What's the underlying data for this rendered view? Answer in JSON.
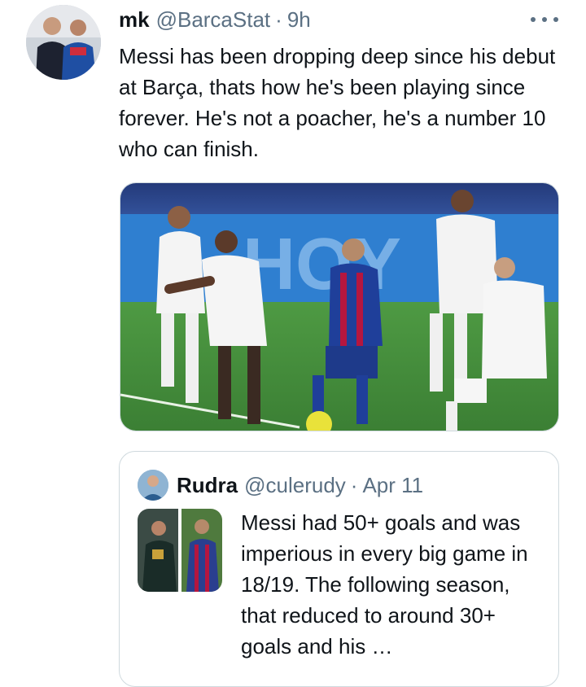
{
  "tweet": {
    "author_name": "mk",
    "author_handle": "@BarcaStat",
    "separator": "·",
    "time": "9h",
    "text": "Messi has been dropping deep since his debut at Barça, thats how he's been playing since forever. He's not a poacher, he's a number 10 who can finish.",
    "media_banner_text": "HOY",
    "more_icon": "more-horizontal-icon"
  },
  "quote": {
    "author_name": "Rudra",
    "author_handle": "@culerudy",
    "separator": "·",
    "date": "Apr 11",
    "text": "Messi had 50+ goals and was imperious in every big game in 18/19. The following season, that reduced to around 30+ goals and his …"
  },
  "colors": {
    "secondary_text": "#5b7083",
    "border": "#cfd9de",
    "pitch_green": "#3f8a3a",
    "real_white": "#f4f4f4",
    "barca_blue": "#1f3f9a",
    "barca_red": "#b5163f"
  }
}
